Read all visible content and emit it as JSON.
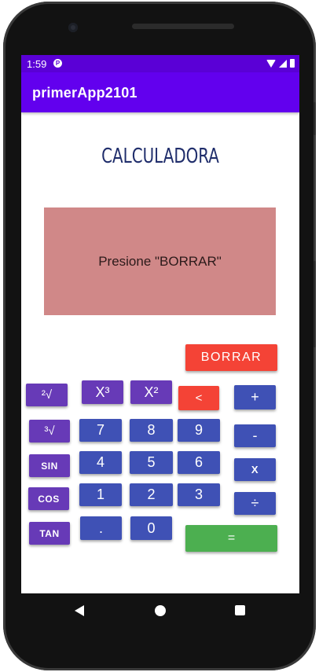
{
  "status_bar": {
    "time": "1:59",
    "icons": [
      "p-icon",
      "wifi-icon",
      "signal-icon",
      "battery-icon"
    ]
  },
  "app_bar": {
    "title": "primerApp2101"
  },
  "heading": "CALCULADORA",
  "display": {
    "text": "Presione \"BORRAR\""
  },
  "buttons": {
    "clear": "BORRAR",
    "sqrt2": "²√",
    "cube": "X³",
    "square": "X²",
    "backspace": "<",
    "plus": "+",
    "cbrt": "³√",
    "d7": "7",
    "d8": "8",
    "d9": "9",
    "minus": "-",
    "sin": "SIN",
    "d4": "4",
    "d5": "5",
    "d6": "6",
    "times": "X",
    "cos": "COS",
    "d1": "1",
    "d2": "2",
    "d3": "3",
    "divide": "÷",
    "tan": "TAN",
    "dot": ".",
    "d0": "0",
    "equals": "="
  },
  "colors": {
    "status_bar": "#5a00d6",
    "app_bar": "#6200ee",
    "display_bg": "#d08888",
    "heading": "#1f2d6b",
    "purple_button": "#673ab7",
    "blue_button": "#3f51b5",
    "red_button": "#f44336",
    "green_button": "#4caf50"
  },
  "nav_bar": {
    "icons": [
      "back-icon",
      "home-icon",
      "recents-icon"
    ]
  }
}
